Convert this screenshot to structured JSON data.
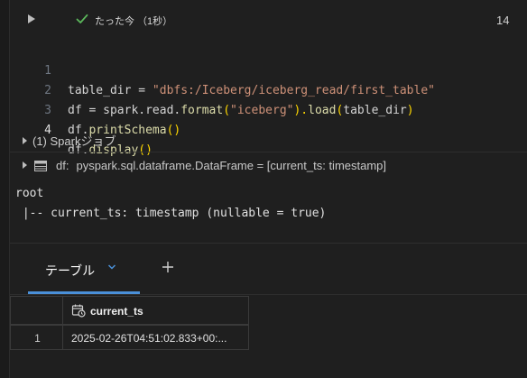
{
  "cell": {
    "status_text": "たった今 （1秒）",
    "cell_number": "14"
  },
  "code": {
    "lines": [
      {
        "num": "1",
        "parts": [
          "table_dir = ",
          "\"dbfs:/Iceberg/iceberg_read/first_table\""
        ]
      },
      {
        "num": "2",
        "parts": [
          "df = spark.read.",
          "format",
          "(",
          "\"iceberg\"",
          ").",
          "load",
          "(",
          "table_dir",
          ")"
        ]
      },
      {
        "num": "3",
        "parts": [
          "df.",
          "printSchema",
          "()"
        ]
      },
      {
        "num": "4",
        "parts": [
          "df.",
          "display",
          "()"
        ]
      }
    ]
  },
  "spark_jobs": {
    "label": "(1) Sparkジョブ"
  },
  "dataframe": {
    "label": "df:",
    "type": "pyspark.sql.dataframe.DataFrame = [current_ts: timestamp]"
  },
  "output": {
    "line1": "root",
    "line2": " |-- current_ts: timestamp (nullable = true)"
  },
  "tabs": {
    "active_label": "テーブル"
  },
  "table": {
    "columns": [
      "current_ts"
    ],
    "rows": [
      {
        "index": "1",
        "current_ts": "2025-02-26T04:51:02.833+00:..."
      }
    ]
  },
  "colors": {
    "accent": "#4a90d9",
    "success": "#5cb85c"
  }
}
